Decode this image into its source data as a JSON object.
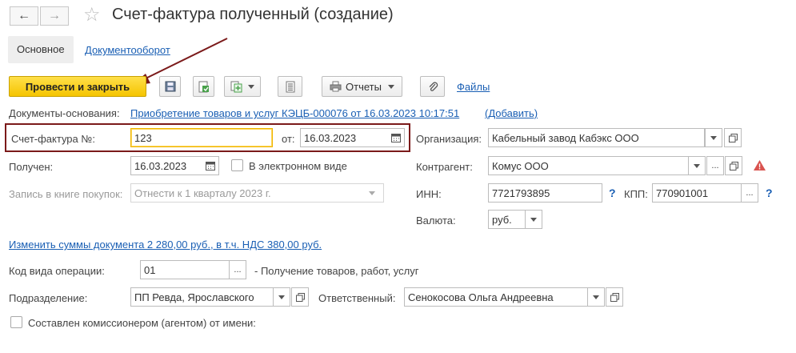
{
  "header": {
    "back_glyph": "←",
    "forward_glyph": "→",
    "star_glyph": "☆",
    "title": "Счет-фактура полученный (создание)"
  },
  "tabs": [
    {
      "label": "Основное"
    },
    {
      "label": "Документооборот"
    }
  ],
  "toolbar": {
    "post_close_label": "Провести и закрыть",
    "reports_label": "Отчеты",
    "files_label": "Файлы"
  },
  "basis": {
    "label": "Документы-основания:",
    "doc_link": "Приобретение товаров и услуг КЭЦБ-000076 от 16.03.2023 10:17:51",
    "add_link": "(Добавить)"
  },
  "form": {
    "invoice_no_label": "Счет-фактура №:",
    "invoice_no_value": "123",
    "from_label": "от:",
    "from_value": "16.03.2023",
    "received_label": "Получен:",
    "received_value": "16.03.2023",
    "electronic_label": "В электронном виде",
    "purchase_book_label": "Запись в книге покупок:",
    "purchase_book_value": "Отнести к 1 кварталу 2023 г.",
    "organization_label": "Организация:",
    "organization_value": "Кабельный завод Кабэкс ООО",
    "counterparty_label": "Контрагент:",
    "counterparty_value": "Комус ООО",
    "inn_label": "ИНН:",
    "inn_value": "7721793895",
    "kpp_label": "КПП:",
    "kpp_value": "770901001",
    "currency_label": "Валюта:",
    "currency_value": "руб.",
    "change_sums_link": "Изменить суммы документа 2 280,00 руб., в т.ч. НДС 380,00 руб.",
    "op_code_label": "Код вида операции:",
    "op_code_value": "01",
    "op_code_desc": "- Получение товаров, работ, услуг",
    "division_label": "Подразделение:",
    "division_value": "ПП Ревда, Ярославского",
    "responsible_label": "Ответственный:",
    "responsible_value": "Сенокосова Ольга Андреевна",
    "agent_label": "Составлен комиссионером (агентом) от имени:",
    "ellipsis": "...",
    "question": "?",
    "warning": "!"
  }
}
